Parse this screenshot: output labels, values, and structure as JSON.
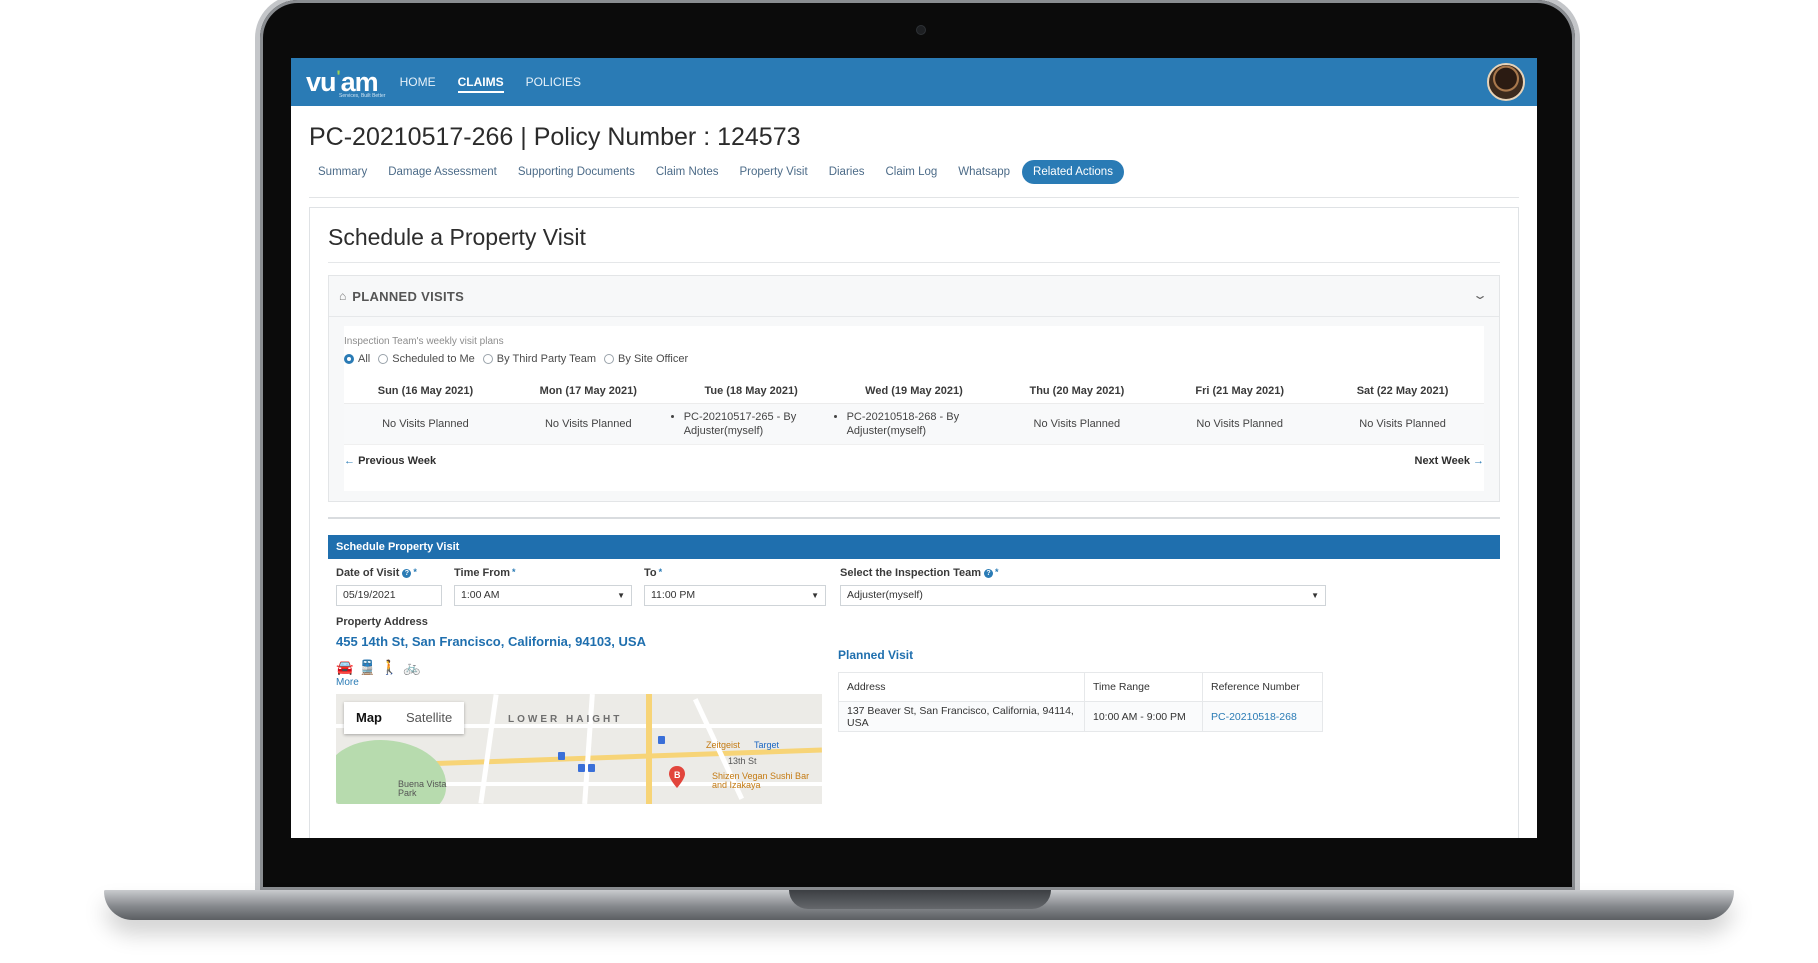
{
  "nav": {
    "logo_main": "vu",
    "logo_tail": "am",
    "logo_sub": "Services, Built Better",
    "items": [
      {
        "label": "HOME"
      },
      {
        "label": "CLAIMS"
      },
      {
        "label": "POLICIES"
      }
    ],
    "active": "CLAIMS"
  },
  "page": {
    "title": "PC-20210517-266 | Policy Number : 124573"
  },
  "tabs": [
    {
      "label": "Summary"
    },
    {
      "label": "Damage Assessment"
    },
    {
      "label": "Supporting Documents"
    },
    {
      "label": "Claim Notes"
    },
    {
      "label": "Property Visit"
    },
    {
      "label": "Diaries"
    },
    {
      "label": "Claim Log"
    },
    {
      "label": "Whatsapp"
    },
    {
      "label": "Related Actions"
    }
  ],
  "active_tab": "Related Actions",
  "schedule": {
    "title": "Schedule a Property Visit",
    "planned_visits_label": "PLANNED VISITS",
    "subheading": "Inspection Team's weekly visit plans",
    "filters": [
      {
        "label": "All",
        "selected": true
      },
      {
        "label": "Scheduled to Me",
        "selected": false
      },
      {
        "label": "By Third Party Team",
        "selected": false
      },
      {
        "label": "By Site Officer",
        "selected": false
      }
    ],
    "week": [
      {
        "day": "Sun (16 May 2021)",
        "text": "No Visits Planned"
      },
      {
        "day": "Mon (17 May 2021)",
        "text": "No Visits Planned"
      },
      {
        "day": "Tue (18 May 2021)",
        "visit": "PC-20210517-265 - By Adjuster(myself)"
      },
      {
        "day": "Wed (19 May 2021)",
        "visit": "PC-20210518-268 - By Adjuster(myself)"
      },
      {
        "day": "Thu (20 May 2021)",
        "text": "No Visits Planned"
      },
      {
        "day": "Fri (21 May 2021)",
        "text": "No Visits Planned"
      },
      {
        "day": "Sat (22 May 2021)",
        "text": "No Visits Planned"
      }
    ],
    "prev_week": "Previous Week",
    "next_week": "Next Week"
  },
  "form": {
    "bar_title": "Schedule Property Visit",
    "date_label": "Date of Visit",
    "date_value": "05/19/2021",
    "time_from_label": "Time From",
    "time_from_value": "1:00 AM",
    "to_label": "To",
    "to_value": "11:00 PM",
    "team_label": "Select the Inspection Team",
    "team_value": "Adjuster(myself)",
    "address_label": "Property Address",
    "address_value": "455 14th St, San Francisco, California, 94103, USA",
    "more_label": "More",
    "transport_icons": [
      "car-icon",
      "transit-icon",
      "walk-icon",
      "bike-icon"
    ]
  },
  "map": {
    "tab_map": "Map",
    "tab_satellite": "Satellite",
    "area_label": "LOWER HAIGHT",
    "park_label": "Buena Vista Park",
    "place_1": "Zeitgeist",
    "place_2": "Target",
    "place_3": "Shizen Vegan Sushi Bar and Izakaya",
    "street_1": "13th St",
    "marker_label": "B"
  },
  "planned_visit": {
    "title": "Planned Visit",
    "columns": [
      "Address",
      "Time Range",
      "Reference Number"
    ],
    "rows": [
      {
        "address": "137 Beaver St, San Francisco, California, 94114, USA",
        "time": "10:00 AM - 9:00 PM",
        "ref": "PC-20210518-268"
      }
    ]
  },
  "colors": {
    "brand_blue": "#2a7bb5",
    "section_bar": "#1f6fae",
    "logo_accent": "#9fd255"
  }
}
